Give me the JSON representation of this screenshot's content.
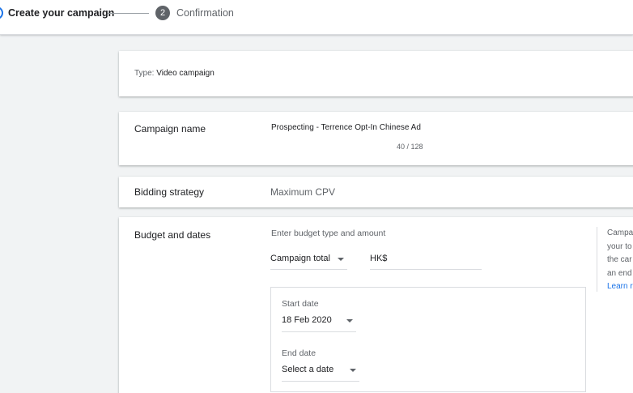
{
  "stepper": {
    "step1_label": "Create your campaign",
    "step2_number": "2",
    "step2_label": "Confirmation"
  },
  "type_card": {
    "key": "Type:",
    "value": "Video campaign"
  },
  "campaign_name": {
    "label": "Campaign name",
    "value": "Prospecting - Terrence Opt-In Chinese Ad",
    "counter": "40 / 128"
  },
  "bidding": {
    "label": "Bidding strategy",
    "value": "Maximum CPV"
  },
  "budget": {
    "label": "Budget and dates",
    "hint": "Enter budget type and amount",
    "type_value": "Campaign total",
    "currency": "HK$",
    "start_label": "Start date",
    "start_value": "18 Feb 2020",
    "end_label": "End date",
    "end_value": "Select a date",
    "help_lines": [
      "Campa",
      "your to",
      "the car",
      "an end"
    ],
    "help_link": "Learn r"
  },
  "colors": {
    "accent": "#1a73e8",
    "background": "#f1f3f4",
    "step_inactive": "#5f6368"
  }
}
